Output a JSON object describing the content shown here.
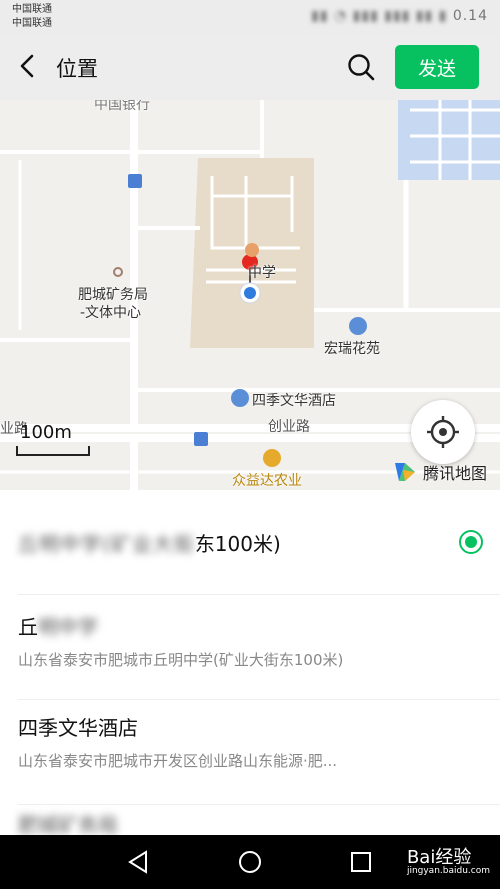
{
  "status_bar": {
    "carrier_1": "中国联通",
    "carrier_2": "中国联通",
    "time": "0.14"
  },
  "header": {
    "title": "位置",
    "send_label": "发送"
  },
  "map": {
    "labels": {
      "bank": "中国银行",
      "school": "中学",
      "bureau_line1": "肥城矿务局",
      "bureau_line2": "-文体中心",
      "garden": "宏瑞花苑",
      "hotel": "四季文华酒店",
      "road": "创业路",
      "road_left": "业路",
      "agri": "众益达农业"
    },
    "scale": "100m",
    "brand": "腾讯地图"
  },
  "results": [
    {
      "name": "丘明中学(矿业大街东100米)",
      "name_visible": "东100米)",
      "address": "",
      "selected": true
    },
    {
      "name": "丘明中学",
      "address": "山东省泰安市肥城市丘明中学(矿业大街东100米)",
      "selected": false
    },
    {
      "name": "四季文华酒店",
      "address": "山东省泰安市肥城市开发区创业路山东能源·肥...",
      "selected": false
    },
    {
      "name": "肥城矿务局",
      "address": "",
      "selected": false
    }
  ],
  "watermark": {
    "brand": "Bai经验",
    "url": "jingyan.baidu.com"
  },
  "colors": {
    "accent": "#07c160",
    "map_bg": "#f2f0ec",
    "school_area": "#e8dccb",
    "water": "#c7d9f2"
  }
}
